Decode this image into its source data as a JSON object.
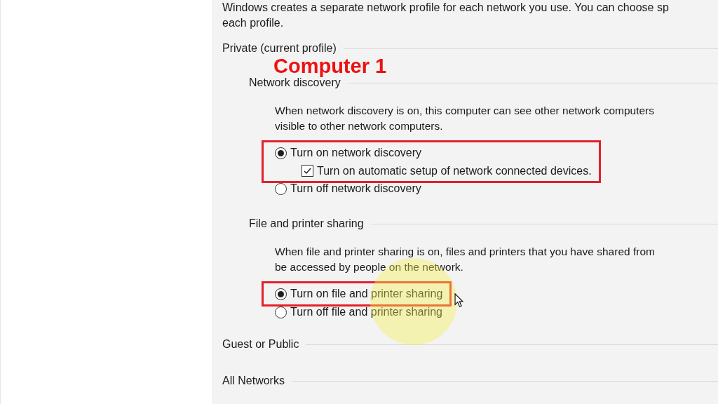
{
  "intro": [
    "Windows creates a separate network profile for each network you use. You can choose sp",
    "each profile."
  ],
  "annotation": {
    "label": "Computer 1"
  },
  "profiles": [
    {
      "title": "Private (current profile)",
      "sections": [
        {
          "title": "Network discovery",
          "description": [
            "When network discovery is on, this computer can see other network computers",
            "visible to other network computers."
          ],
          "options": [
            {
              "kind": "radio",
              "label": "Turn on network discovery",
              "selected": true,
              "highlighted": true,
              "children": [
                {
                  "kind": "checkbox",
                  "label": "Turn on automatic setup of network connected devices.",
                  "checked": true
                }
              ]
            },
            {
              "kind": "radio",
              "label": "Turn off network discovery",
              "selected": false,
              "highlighted": false
            }
          ]
        },
        {
          "title": "File and printer sharing",
          "description": [
            "When file and printer sharing is on, files and printers that you have shared from",
            "be accessed by people on the network."
          ],
          "options": [
            {
              "kind": "radio",
              "label": "Turn on file and printer sharing",
              "selected": true,
              "highlighted": true
            },
            {
              "kind": "radio",
              "label": "Turn off file and printer sharing",
              "selected": false,
              "highlighted": false
            }
          ]
        }
      ]
    },
    {
      "title": "Guest or Public"
    },
    {
      "title": "All Networks"
    }
  ]
}
